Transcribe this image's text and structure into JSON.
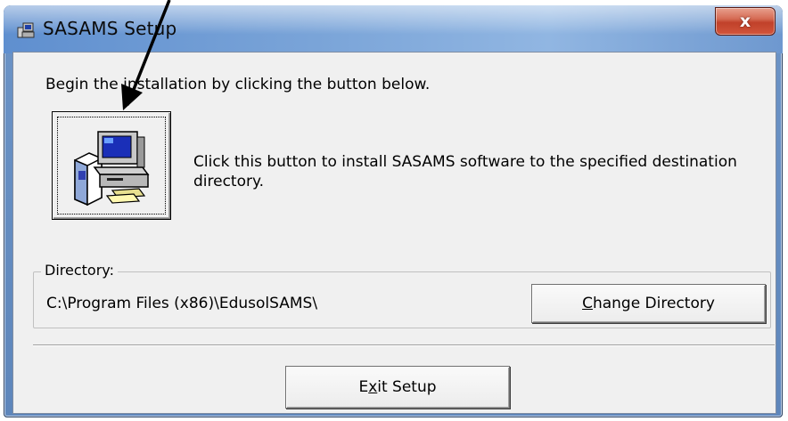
{
  "window": {
    "title": "SASAMS Setup",
    "close_glyph": "x"
  },
  "main": {
    "intro_text": "Begin the installation by clicking the button below.",
    "install_icon": "setup-computer-icon",
    "install_description": "Click this button to install SASAMS software to the specified destination directory.",
    "directory_label": "Directory:",
    "directory_path": "C:\\Program Files (x86)\\EdusolSAMS\\",
    "change_directory_label": "Change Directory",
    "exit_setup_label": "Exit Setup"
  },
  "annotation": {
    "arrow_color": "#000000"
  }
}
